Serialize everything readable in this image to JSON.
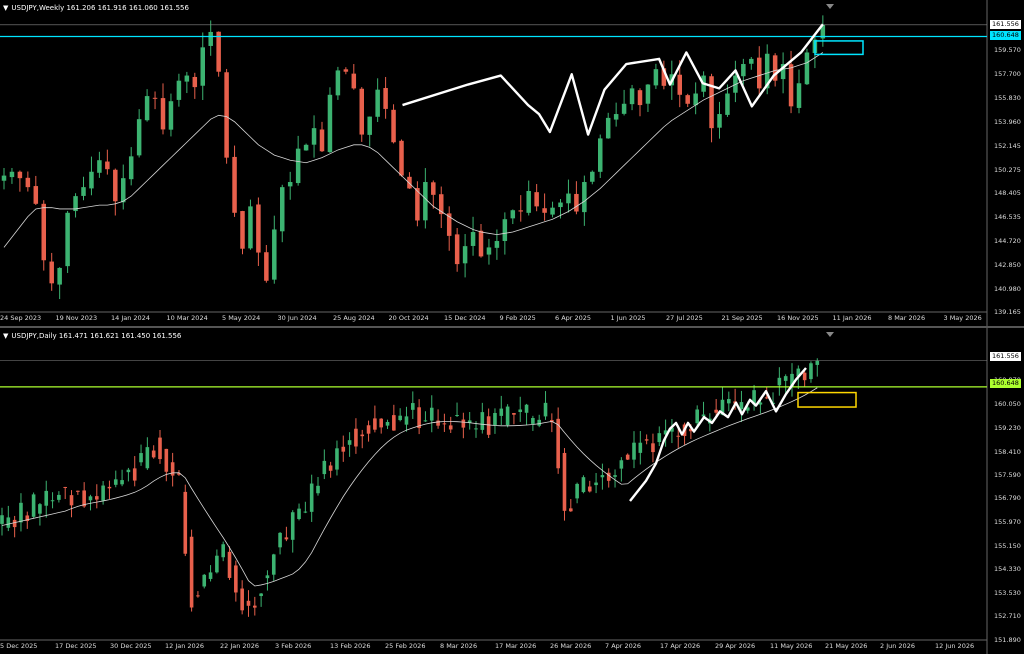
{
  "colors": {
    "background": "#000000",
    "bull": "#3cb371",
    "bear": "#e8604c",
    "ma": "#d8d8d8",
    "zigzag": "#ffffff",
    "cyan_level": "#00e5ff",
    "yellow_green_level": "#adff2f",
    "cyan_box": "#00e5ff",
    "yellow_box": "#ffd700",
    "bid_line": "#888888"
  },
  "weekly": {
    "title": "USDJPY,Weekly  161.206 161.916 161.060 161.556",
    "symbol": "USDJPY",
    "timeframe": "Weekly",
    "ohlc": {
      "open": "161.206",
      "high": "161.916",
      "low": "161.060",
      "close": "161.556"
    },
    "price_labels": [
      "161.556",
      "160.648",
      "159.570",
      "157.700",
      "155.830",
      "153.960",
      "152.145",
      "150.275",
      "148.405",
      "146.535",
      "144.720",
      "142.850",
      "140.980",
      "139.165"
    ],
    "bid_tag": "161.556",
    "level_tag": "160.648",
    "time_labels": [
      "24 Sep 2023",
      "19 Nov 2023",
      "14 Jan 2024",
      "10 Mar 2024",
      "5 May 2024",
      "30 Jun 2024",
      "25 Aug 2024",
      "20 Oct 2024",
      "15 Dec 2024",
      "9 Feb 2025",
      "6 Apr 2025",
      "1 Jun 2025",
      "27 Jul 2025",
      "21 Sep 2025",
      "16 Nov 2025",
      "11 Jan 2026",
      "8 Mar 2026",
      "3 May 2026"
    ],
    "ylim": [
      139.165,
      162.4
    ],
    "closes": [
      149.8,
      150.1,
      149.6,
      148.9,
      147.6,
      143.2,
      141.4,
      142.6,
      146.9,
      148.2,
      148.9,
      150.1,
      151.0,
      150.3,
      147.8,
      149.6,
      151.3,
      154.2,
      156.0,
      155.8,
      153.4,
      155.6,
      157.2,
      157.6,
      156.7,
      159.8,
      161.0,
      157.9,
      151.2,
      146.9,
      144.1,
      147.4,
      143.8,
      141.6,
      145.6,
      148.9,
      149.3,
      151.9,
      152.2,
      153.5,
      151.7,
      156.1,
      158.0,
      157.9,
      156.6,
      153.0,
      154.4,
      156.5,
      155.0,
      152.4,
      149.8,
      148.8,
      146.3,
      149.3,
      148.3,
      146.8,
      145.1,
      142.9,
      144.3,
      145.4,
      143.5,
      144.2,
      144.7,
      146.4,
      147.1,
      147.0,
      148.6,
      147.4,
      146.9,
      147.3,
      147.7,
      148.4,
      147.0,
      149.3,
      150.1,
      152.7,
      154.3,
      154.6,
      155.4,
      156.6,
      155.3,
      156.9,
      158.1,
      156.8,
      157.7,
      156.1,
      155.4,
      156.2,
      157.6,
      153.5,
      154.6,
      156.2,
      157.6,
      158.5,
      158.9,
      156.6,
      159.3,
      157.2,
      158.5,
      155.2,
      157.0,
      159.4,
      160.4,
      161.556
    ],
    "ma": [
      144.2,
      145.0,
      145.8,
      146.6,
      147.2,
      147.3,
      147.3,
      147.2,
      147.2,
      147.2,
      147.3,
      147.4,
      147.5,
      147.5,
      147.6,
      147.8,
      148.2,
      148.8,
      149.4,
      150.0,
      150.6,
      151.2,
      151.8,
      152.4,
      153.0,
      153.6,
      154.2,
      154.5,
      154.4,
      154.0,
      153.4,
      152.8,
      152.2,
      151.8,
      151.4,
      151.2,
      151.0,
      150.9,
      150.8,
      151.0,
      151.2,
      151.5,
      151.8,
      152.0,
      152.2,
      152.2,
      152.0,
      151.6,
      151.0,
      150.4,
      149.8,
      149.2,
      148.6,
      148.0,
      147.4,
      147.0,
      146.6,
      146.2,
      145.9,
      145.6,
      145.4,
      145.3,
      145.2,
      145.3,
      145.4,
      145.6,
      145.8,
      146.0,
      146.2,
      146.4,
      146.7,
      147.0,
      147.4,
      147.8,
      148.3,
      148.8,
      149.4,
      150.0,
      150.6,
      151.2,
      151.8,
      152.4,
      153.0,
      153.6,
      154.1,
      154.5,
      154.9,
      155.3,
      155.7,
      156.0,
      156.3,
      156.6,
      156.9,
      157.2,
      157.4,
      157.6,
      157.8,
      158.0,
      158.1,
      158.2,
      158.4,
      158.6,
      159.0,
      159.4
    ],
    "zigzag": [
      [
        146,
        155.3
      ],
      [
        170,
        156.9
      ],
      [
        182,
        157.6
      ],
      [
        192,
        155.3
      ],
      [
        196,
        154.6
      ],
      [
        200,
        153.2
      ],
      [
        208,
        157.7
      ],
      [
        214,
        153.0
      ],
      [
        220,
        156.5
      ],
      [
        228,
        158.5
      ],
      [
        240,
        158.9
      ],
      [
        244,
        156.9
      ],
      [
        250,
        159.4
      ],
      [
        256,
        157.0
      ],
      [
        262,
        156.6
      ],
      [
        268,
        158.0
      ],
      [
        274,
        155.2
      ],
      [
        282,
        157.6
      ],
      [
        292,
        159.4
      ],
      [
        300,
        161.6
      ]
    ],
    "level": 160.648
  },
  "daily": {
    "title": "USDJPY,Daily  161.471 161.621 161.450 161.556",
    "symbol": "USDJPY",
    "timeframe": "Daily",
    "ohlc": {
      "open": "161.471",
      "high": "161.621",
      "low": "161.450",
      "close": "161.556"
    },
    "price_labels": [
      "161.556",
      "160.870",
      "160.648",
      "160.050",
      "159.230",
      "158.410",
      "157.590",
      "156.790",
      "155.970",
      "155.150",
      "154.330",
      "153.530",
      "152.710",
      "151.890"
    ],
    "bid_tag": "161.556",
    "level_tag": "160.648",
    "time_labels": [
      "5 Dec 2025",
      "17 Dec 2025",
      "30 Dec 2025",
      "12 Jan 2026",
      "22 Jan 2026",
      "3 Feb 2026",
      "13 Feb 2026",
      "25 Feb 2026",
      "8 Mar 2026",
      "17 Mar 2026",
      "26 Mar 2026",
      "7 Apr 2026",
      "17 Apr 2026",
      "29 Apr 2026",
      "11 May 2026",
      "21 May 2026",
      "2 Jun 2026",
      "12 Jun 2026"
    ],
    "ylim": [
      151.89,
      162.2
    ],
    "level": 160.648
  }
}
